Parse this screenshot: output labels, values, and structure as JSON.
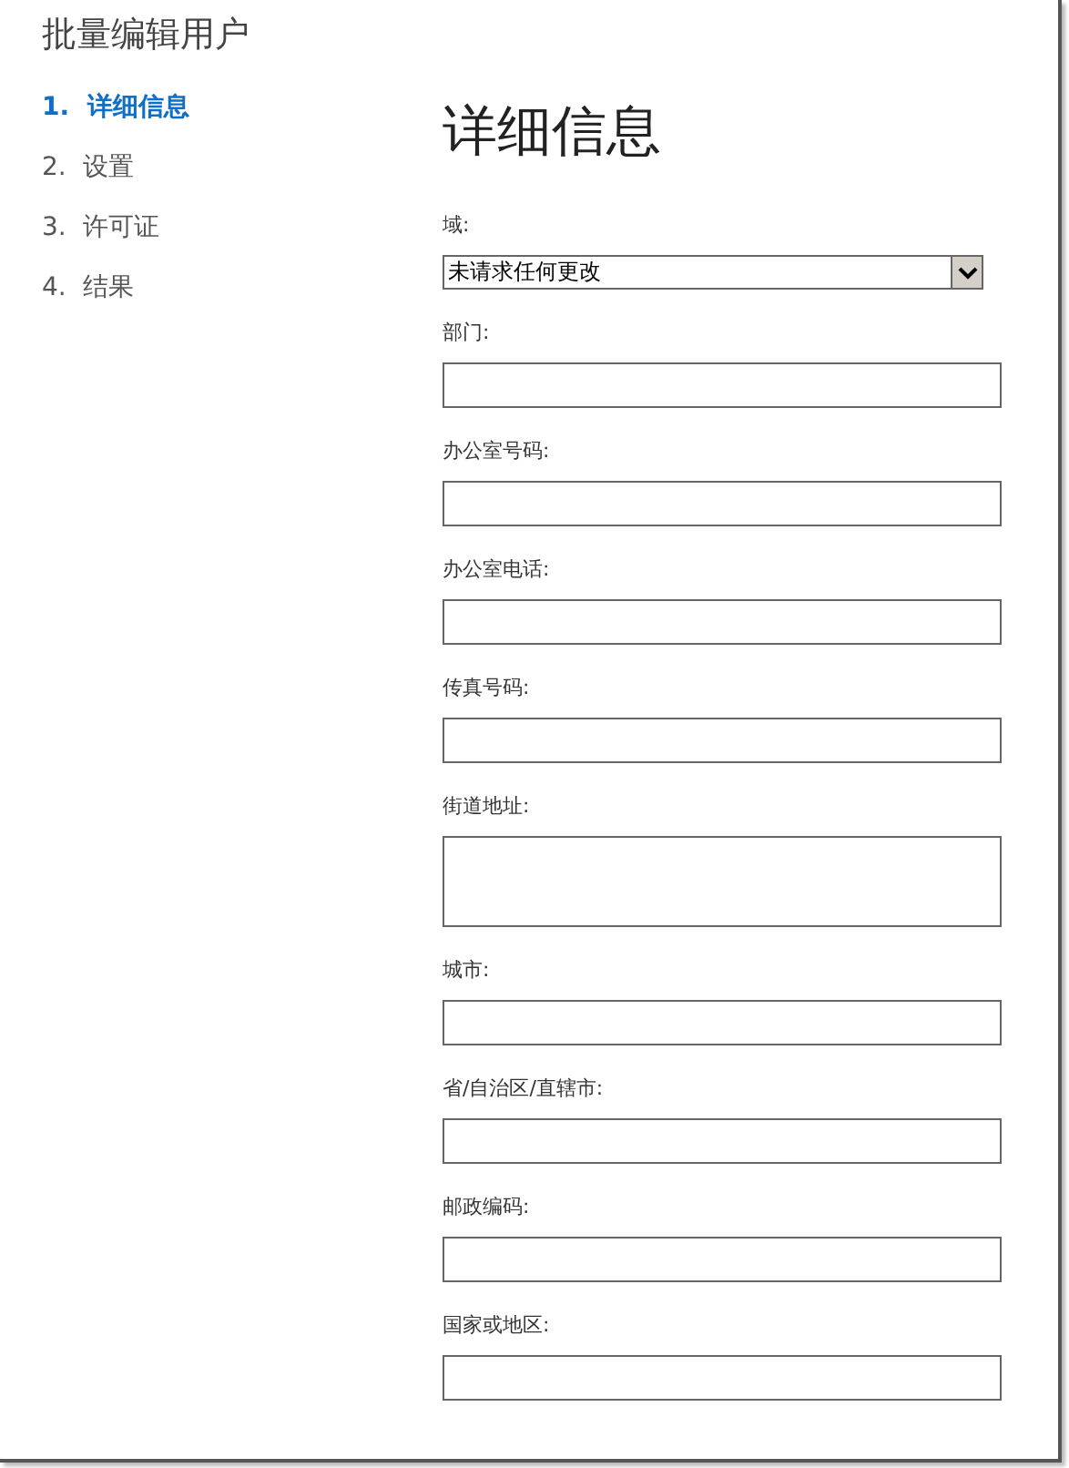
{
  "window": {
    "title": "批量编辑用户"
  },
  "steps": [
    {
      "number": "1.",
      "label": "详细信息",
      "selected": true
    },
    {
      "number": "2.",
      "label": "设置",
      "selected": false
    },
    {
      "number": "3.",
      "label": "许可证",
      "selected": false
    },
    {
      "number": "4.",
      "label": "结果",
      "selected": false
    }
  ],
  "heading": "详细信息",
  "fields": [
    {
      "kind": "select",
      "label": "域:",
      "value": "未请求任何更改"
    },
    {
      "kind": "text",
      "label": "部门:"
    },
    {
      "kind": "text",
      "label": "办公室号码:"
    },
    {
      "kind": "text",
      "label": "办公室电话:"
    },
    {
      "kind": "text",
      "label": "传真号码:"
    },
    {
      "kind": "textarea",
      "label": "街道地址:"
    },
    {
      "kind": "text",
      "label": "城市:"
    },
    {
      "kind": "text",
      "label": "省/自治区/直辖市:"
    },
    {
      "kind": "text",
      "label": "邮政编码:"
    },
    {
      "kind": "text",
      "label": "国家或地区:"
    }
  ]
}
